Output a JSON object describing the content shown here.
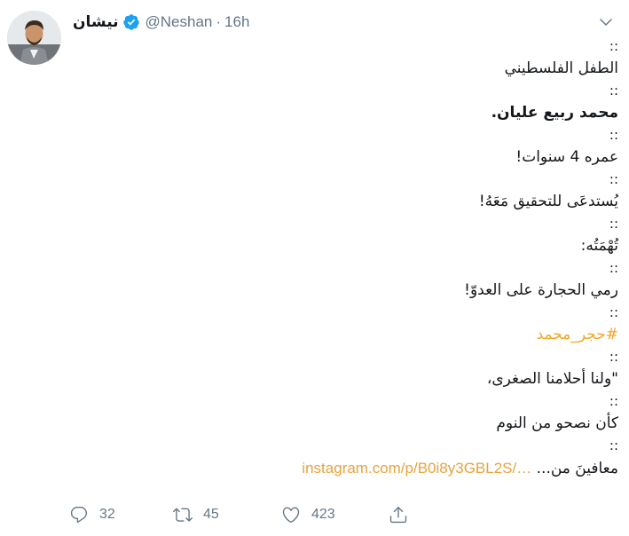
{
  "tweet": {
    "display_name": "نيشان",
    "handle": "@Neshan",
    "separator": "·",
    "time": "16h",
    "lines": [
      "::",
      "الطفل الفلسطيني",
      "::",
      "محمد ربيع عليان.",
      "::",
      "عمره 4 سنوات!",
      "::",
      "يُستدعَى للتحقيق مَعَهُ!",
      "::",
      "تُهْمَتُه:",
      "::",
      "رمي الحجارة على العدوّ!",
      "::",
      "#حجر_محمد",
      "::",
      "\"ولنا أحلامنا الصغرى،",
      "::",
      "كأن نصحو من النوم",
      "::"
    ],
    "last_line_text": "معافينَ من...",
    "link_text": "instagram.com/p/B0i8y3GBL2S/…"
  },
  "actions": {
    "replies": "32",
    "retweets": "45",
    "likes": "423"
  },
  "icons": {
    "verified": "verified-badge-icon",
    "chevron": "chevron-down-icon",
    "reply": "reply-icon",
    "retweet": "retweet-icon",
    "like": "heart-icon",
    "share": "share-icon"
  },
  "colors": {
    "link": "#e8a33b",
    "hashtag": "#f5a623",
    "verified": "#1da1f2",
    "secondary_text": "#657786"
  }
}
